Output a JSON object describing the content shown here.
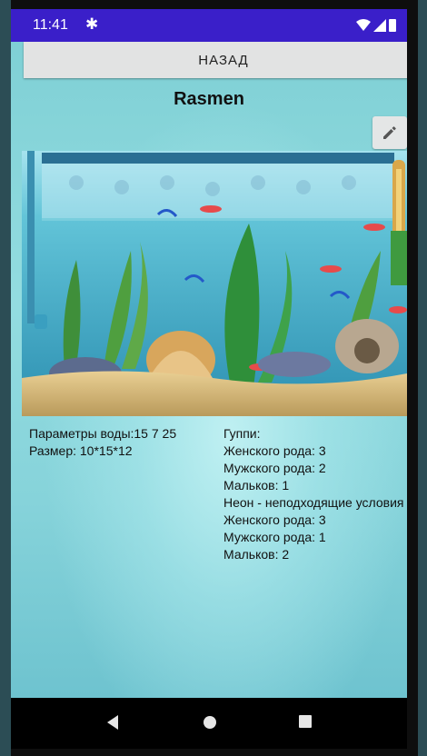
{
  "status_bar": {
    "time": "11:41",
    "icons": [
      "settings-icon",
      "wifi-icon",
      "signal-icon",
      "battery-icon"
    ]
  },
  "header": {
    "back_label": "НАЗАД",
    "title": "Rasmen"
  },
  "edit_icon": "pencil-icon",
  "aquarium_image": "aquarium-illustration",
  "parameters": {
    "water": "Параметры воды:15 7 25",
    "size": "Размер: 10*15*12"
  },
  "fish": [
    "Гуппи:",
    "Женского рода: 3",
    "Мужского рода: 2",
    "Мальков: 1",
    "Неон - неподходящие условия",
    "Женского рода: 3",
    "Мужского рода: 1",
    "Мальков: 2"
  ],
  "nav": [
    "back-icon",
    "home-icon",
    "recents-icon"
  ],
  "colors": {
    "status_bar": "#3a1fc9",
    "screen_bg": "#8fd9de",
    "button_bg": "#e2e3e3"
  }
}
